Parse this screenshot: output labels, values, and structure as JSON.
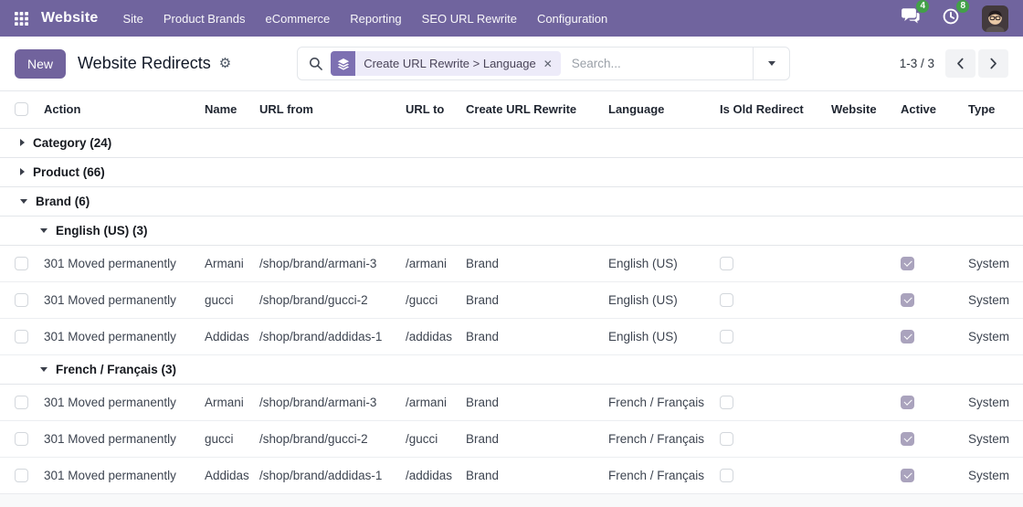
{
  "colors": {
    "navbar_bg": "#70649e",
    "primary": "#71639d",
    "badge_green": "#42a048",
    "facet_icon_bg": "#7d70b2",
    "facet_bg": "#edebf9",
    "checked_checkbox": "#aaa3bd"
  },
  "icons": {
    "facet_remove": "✕",
    "settings_gear": "⚙"
  },
  "navbar": {
    "brand": "Website",
    "menus": [
      {
        "label": "Site"
      },
      {
        "label": "Product Brands"
      },
      {
        "label": "eCommerce"
      },
      {
        "label": "Reporting"
      },
      {
        "label": "SEO URL Rewrite"
      },
      {
        "label": "Configuration"
      }
    ],
    "messages_badge": "4",
    "activities_badge": "8"
  },
  "control_panel": {
    "new_button_label": "New",
    "title": "Website Redirects",
    "search": {
      "facet_value": "Create URL Rewrite > Language",
      "placeholder": "Search..."
    },
    "pager_text": "1-3 / 3"
  },
  "table": {
    "columns": [
      "Action",
      "Name",
      "URL from",
      "URL to",
      "Create URL Rewrite",
      "Language",
      "Is Old Redirect",
      "Website",
      "Active",
      "Type"
    ],
    "groups": [
      {
        "label": "Category (24)",
        "expanded": false,
        "subgroups": []
      },
      {
        "label": "Product (66)",
        "expanded": false,
        "subgroups": []
      },
      {
        "label": "Brand (6)",
        "expanded": true,
        "subgroups": [
          {
            "label": "English (US) (3)",
            "rows": [
              {
                "action": "301 Moved permanently",
                "name": "Armani",
                "url_from": "/shop/brand/armani-3",
                "url_to": "/armani",
                "create_url_rewrite": "Brand",
                "language": "English (US)",
                "is_old_redirect": false,
                "website": "",
                "active": true,
                "type": "System"
              },
              {
                "action": "301 Moved permanently",
                "name": "gucci",
                "url_from": "/shop/brand/gucci-2",
                "url_to": "/gucci",
                "create_url_rewrite": "Brand",
                "language": "English (US)",
                "is_old_redirect": false,
                "website": "",
                "active": true,
                "type": "System"
              },
              {
                "action": "301 Moved permanently",
                "name": "Addidas",
                "url_from": "/shop/brand/addidas-1",
                "url_to": "/addidas",
                "create_url_rewrite": "Brand",
                "language": "English (US)",
                "is_old_redirect": false,
                "website": "",
                "active": true,
                "type": "System"
              }
            ]
          },
          {
            "label": "French / Français (3)",
            "rows": [
              {
                "action": "301 Moved permanently",
                "name": "Armani",
                "url_from": "/shop/brand/armani-3",
                "url_to": "/armani",
                "create_url_rewrite": "Brand",
                "language": "French / Français",
                "is_old_redirect": false,
                "website": "",
                "active": true,
                "type": "System"
              },
              {
                "action": "301 Moved permanently",
                "name": "gucci",
                "url_from": "/shop/brand/gucci-2",
                "url_to": "/gucci",
                "create_url_rewrite": "Brand",
                "language": "French / Français",
                "is_old_redirect": false,
                "website": "",
                "active": true,
                "type": "System"
              },
              {
                "action": "301 Moved permanently",
                "name": "Addidas",
                "url_from": "/shop/brand/addidas-1",
                "url_to": "/addidas",
                "create_url_rewrite": "Brand",
                "language": "French / Français",
                "is_old_redirect": false,
                "website": "",
                "active": true,
                "type": "System"
              }
            ]
          }
        ]
      }
    ]
  }
}
